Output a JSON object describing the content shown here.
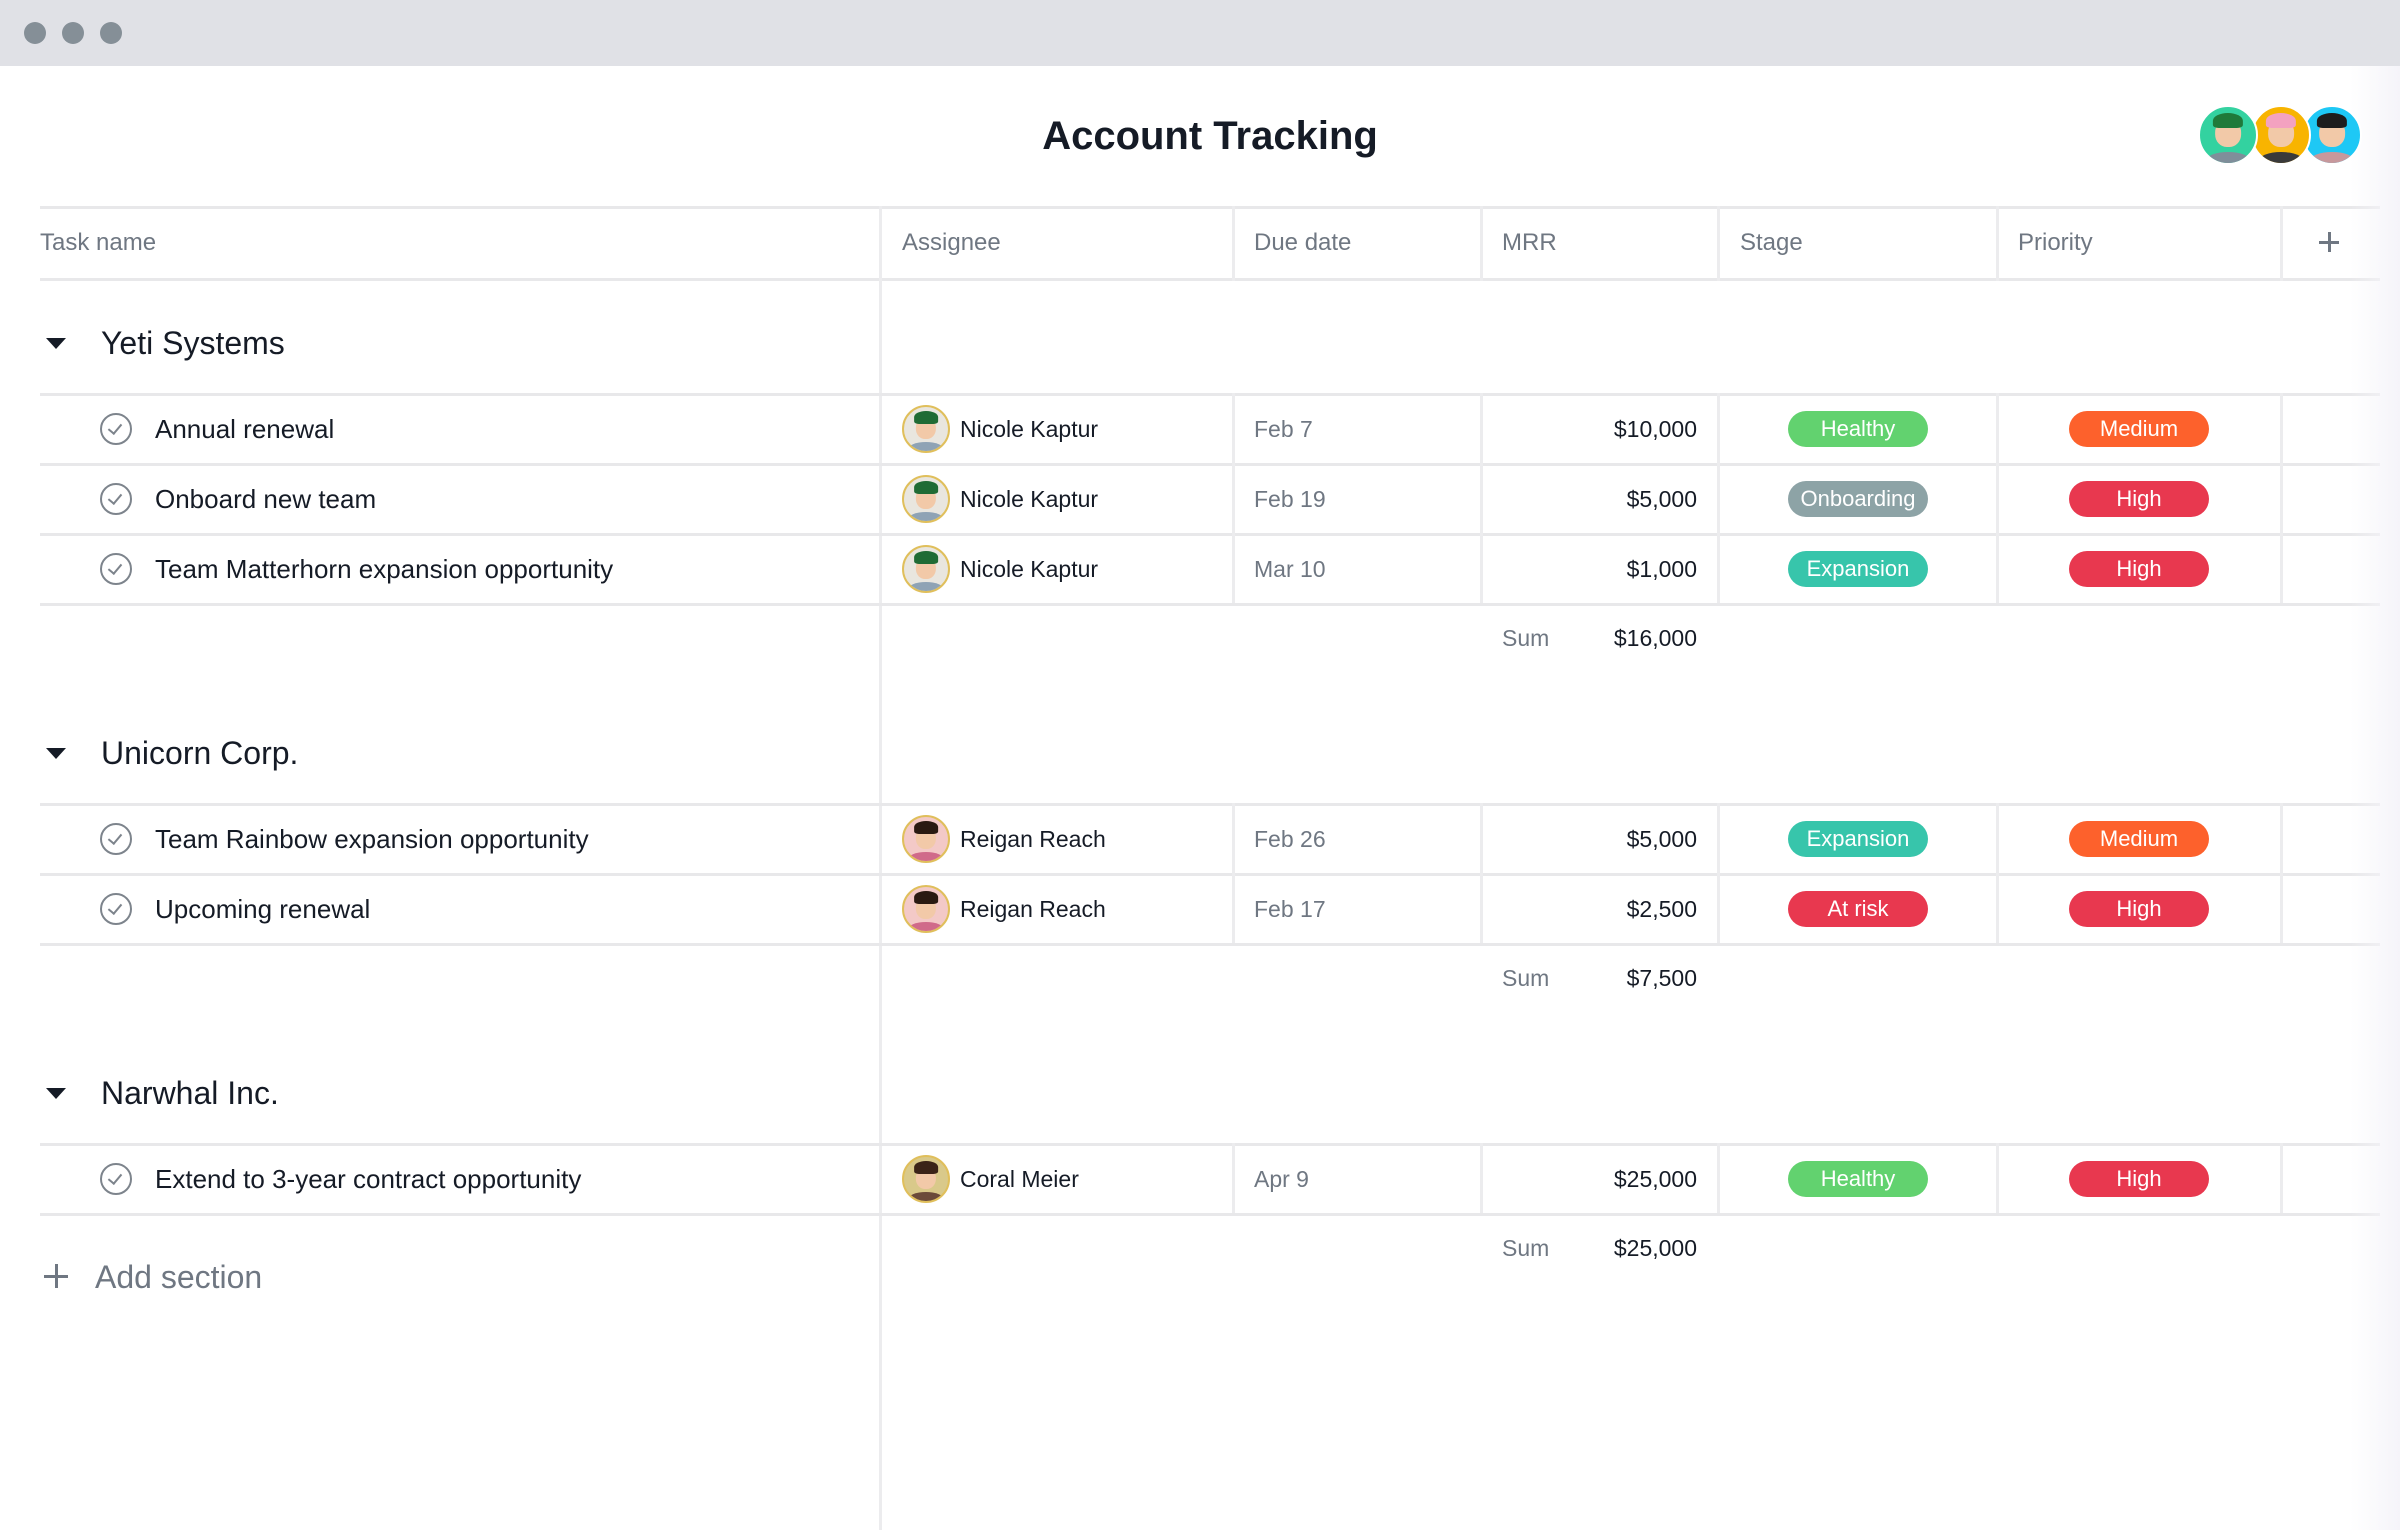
{
  "window": {
    "controls": [
      "close",
      "minimize",
      "zoom"
    ]
  },
  "page": {
    "title": "Account Tracking"
  },
  "members": [
    {
      "name": "member-1",
      "bg": "#33d2a0",
      "hair": "#4a3220",
      "body": "#7f8e9a",
      "hat": "#1f7a3a"
    },
    {
      "name": "member-2",
      "bg": "#f8b400",
      "hair": "#f3a2c0",
      "body": "#3a3a3a"
    },
    {
      "name": "member-3",
      "bg": "#1ec8f5",
      "hair": "#1d1d1d",
      "body": "#c7989c"
    }
  ],
  "columns": {
    "task_name": "Task name",
    "assignee": "Assignee",
    "due_date": "Due date",
    "mrr": "MRR",
    "stage": "Stage",
    "priority": "Priority",
    "add_column_icon": "plus-icon"
  },
  "sum_label": "Sum",
  "add_section_label": "Add section",
  "colors": {
    "Healthy": "#62d26f",
    "Onboarding": "#8da3a6",
    "Expansion": "#37c5ab",
    "At risk": "#e8384f",
    "Medium": "#fd612c",
    "High": "#e8384f"
  },
  "sections": [
    {
      "name": "Yeti Systems",
      "sum": "$16,000",
      "tasks": [
        {
          "name": "Annual renewal",
          "assignee": "Nicole Kaptur",
          "due": "Feb 7",
          "mrr": "$10,000",
          "stage": "Healthy",
          "priority": "Medium"
        },
        {
          "name": "Onboard new team",
          "assignee": "Nicole Kaptur",
          "due": "Feb 19",
          "mrr": "$5,000",
          "stage": "Onboarding",
          "priority": "High"
        },
        {
          "name": "Team Matterhorn expansion opportunity",
          "assignee": "Nicole Kaptur",
          "due": "Mar 10",
          "mrr": "$1,000",
          "stage": "Expansion",
          "priority": "High"
        }
      ]
    },
    {
      "name": "Unicorn Corp.",
      "sum": "$7,500",
      "tasks": [
        {
          "name": "Team Rainbow expansion opportunity",
          "assignee": "Reigan Reach",
          "due": "Feb 26",
          "mrr": "$5,000",
          "stage": "Expansion",
          "priority": "Medium"
        },
        {
          "name": "Upcoming renewal",
          "assignee": "Reigan Reach",
          "due": "Feb 17",
          "mrr": "$2,500",
          "stage": "At risk",
          "priority": "High"
        }
      ]
    },
    {
      "name": "Narwhal Inc.",
      "sum": "$25,000",
      "tasks": [
        {
          "name": "Extend to 3-year contract opportunity",
          "assignee": "Coral Meier",
          "due": "Apr 9",
          "mrr": "$25,000",
          "stage": "Healthy",
          "priority": "High"
        }
      ]
    }
  ],
  "assignee_avatars": {
    "Nicole Kaptur": {
      "bg": "#e9e6df",
      "hair": "#1f6b35",
      "body": "#8fa3b5"
    },
    "Reigan Reach": {
      "bg": "#f3c9c7",
      "hair": "#2a1a12",
      "body": "#d06a8a"
    },
    "Coral Meier": {
      "bg": "#d9c98a",
      "hair": "#3b2418",
      "body": "#6b4a3a"
    }
  }
}
